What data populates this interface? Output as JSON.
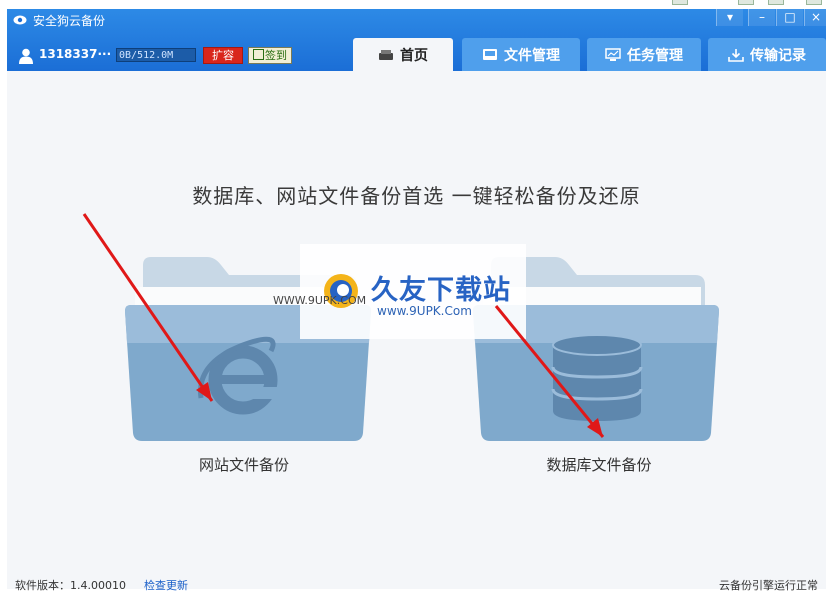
{
  "window": {
    "title": "安全狗云备份",
    "buttons": [
      "▾",
      "–",
      "□",
      "×"
    ]
  },
  "user": {
    "name": "1318337···",
    "quota": "0B/512.0M",
    "expand_label": "扩容",
    "sign_label": "签到"
  },
  "tabs": [
    {
      "label": "首页",
      "icon": "drive-icon",
      "active": true
    },
    {
      "label": "文件管理",
      "icon": "file-manager-icon",
      "active": false
    },
    {
      "label": "任务管理",
      "icon": "monitor-icon",
      "active": false
    },
    {
      "label": "传输记录",
      "icon": "download-icon",
      "active": false
    }
  ],
  "main": {
    "slogan": "数据库、网站文件备份首选  一键轻松备份及还原",
    "website_backup_label": "网站文件备份",
    "database_backup_label": "数据库文件备份"
  },
  "watermark": {
    "title": "久友下载站",
    "url": "www.9UPK.Com",
    "url_left": "WWW.9UPK.COM"
  },
  "footer": {
    "version": "软件版本：1.4.00010",
    "check_update": "检查更新",
    "status": "云备份引擎运行正常"
  },
  "colors": {
    "header": "#1b6ed6",
    "tab": "#4f9fec",
    "folder": "#7fa9cc",
    "arrow": "#e01818"
  }
}
